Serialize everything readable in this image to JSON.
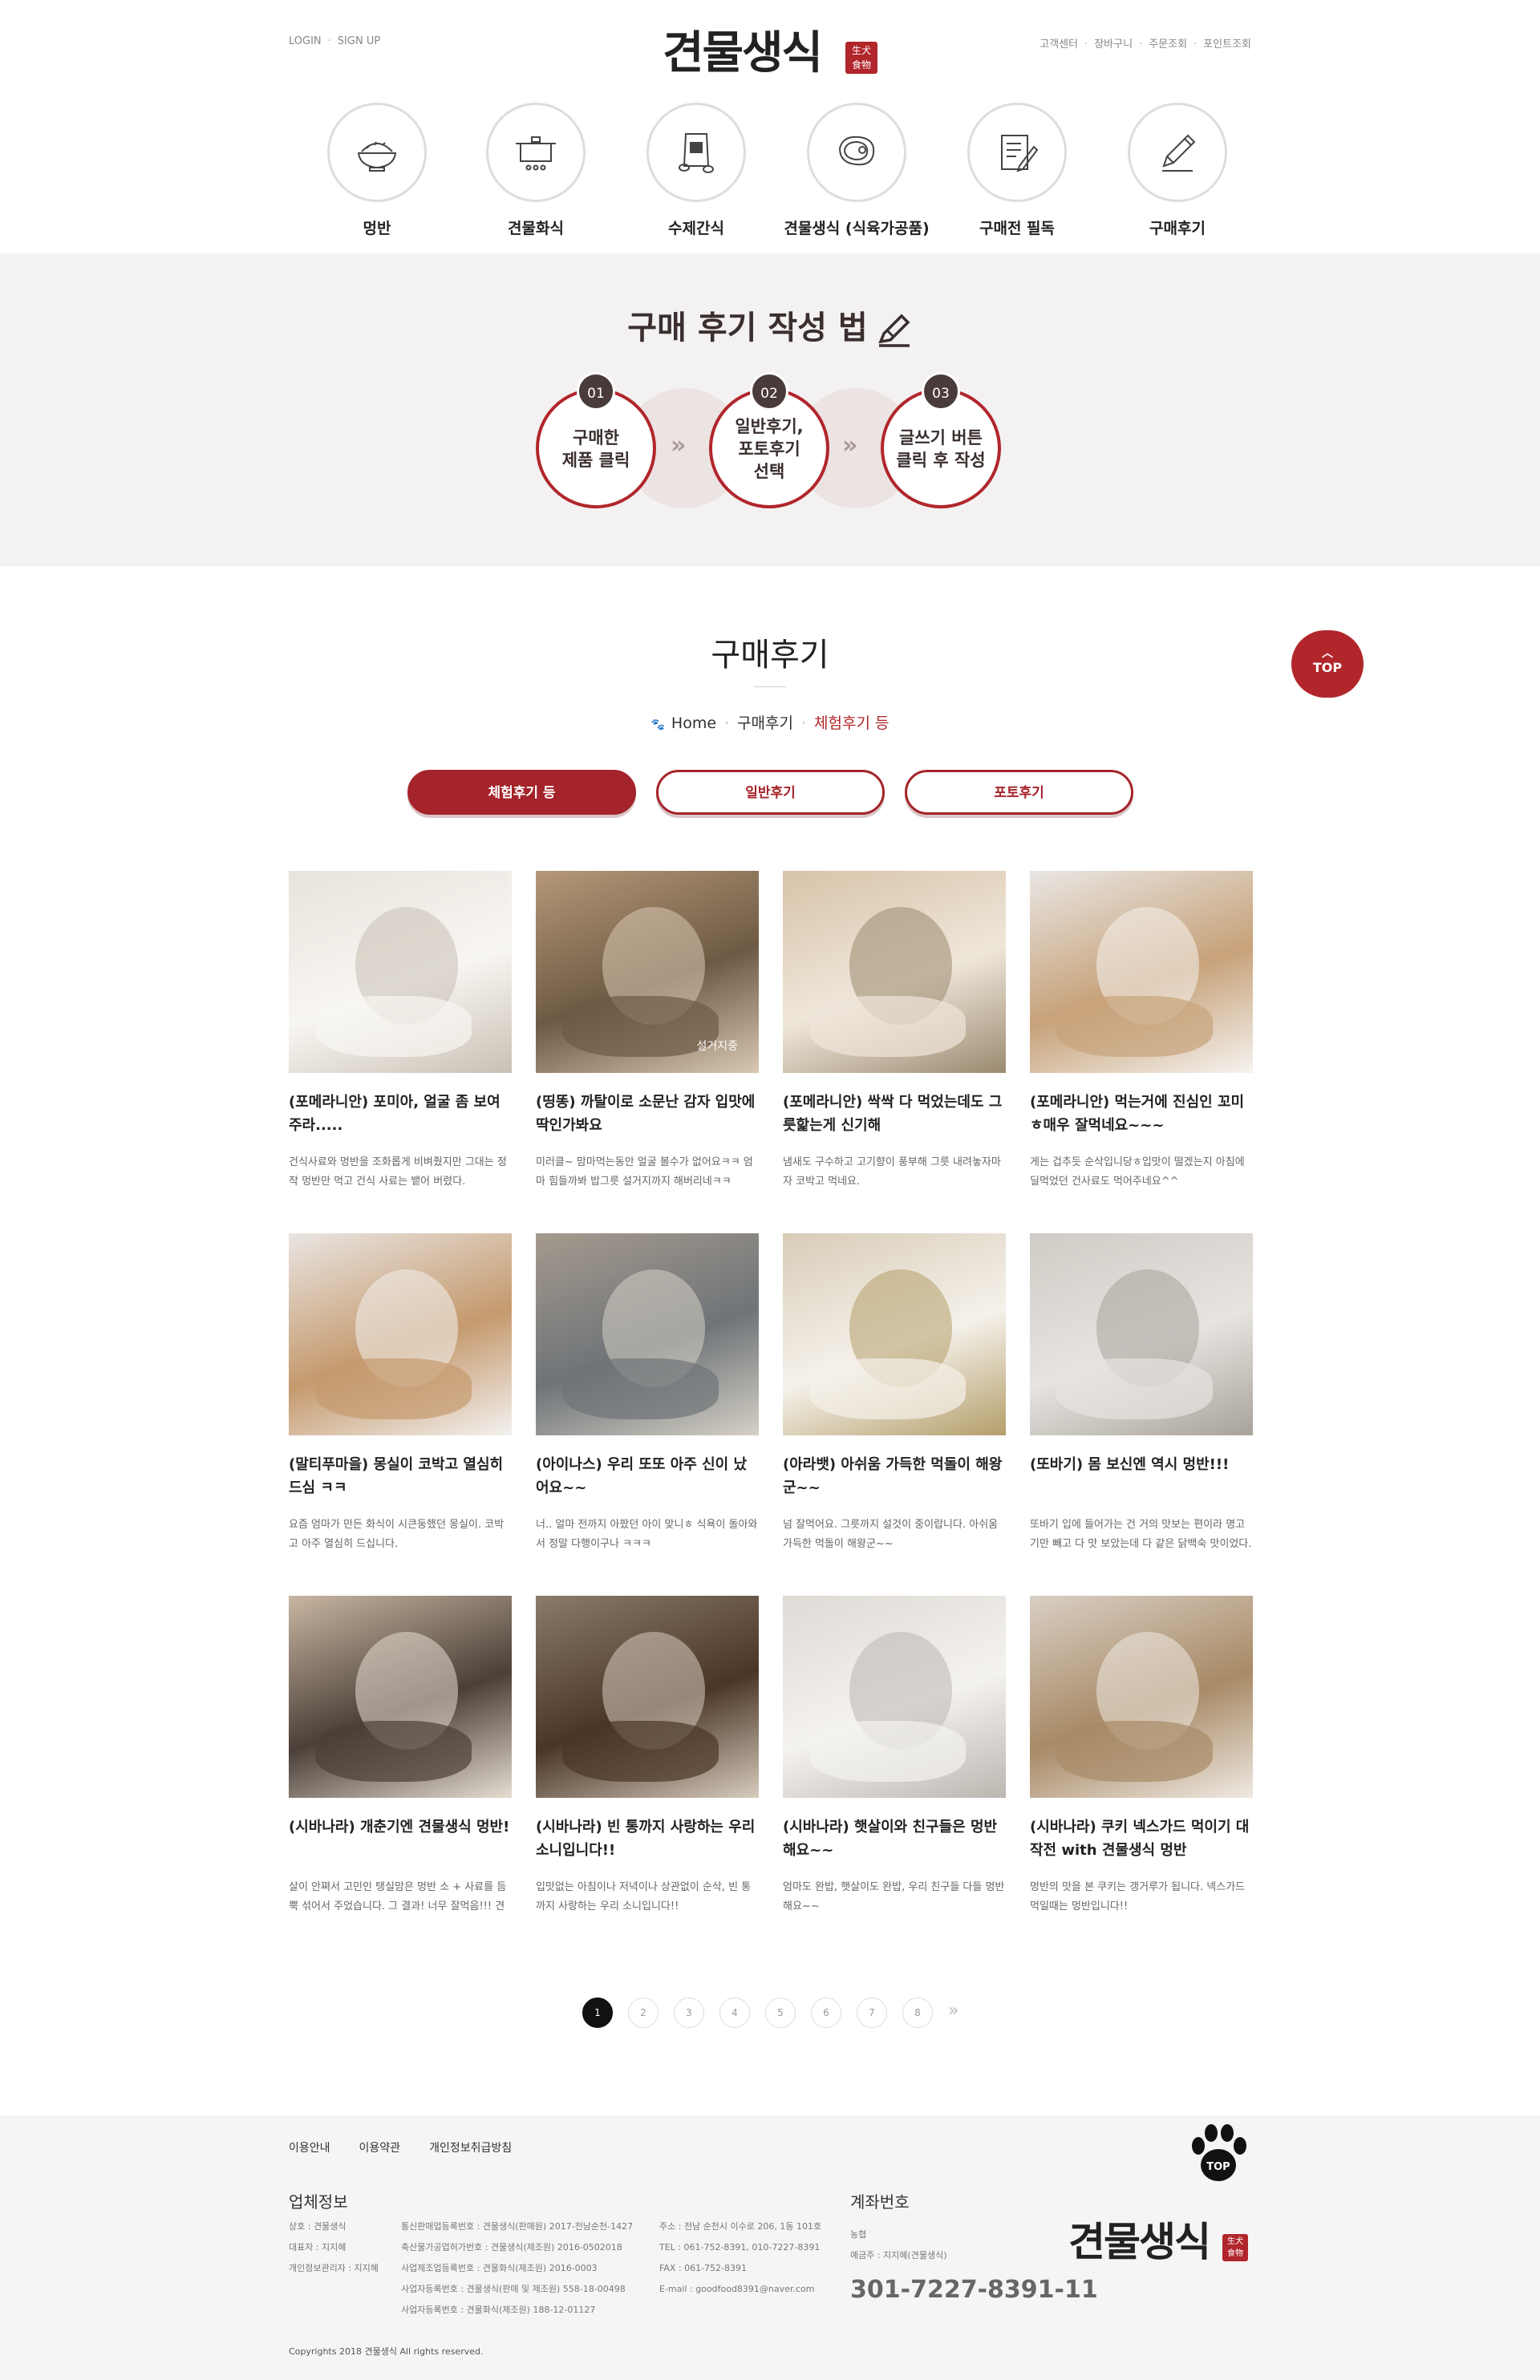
{
  "header": {
    "login": "LOGIN",
    "signup": "SIGN UP",
    "logo_text": "견물생식",
    "logo_seal": "生犬食物",
    "util": [
      "고객센터",
      "장바구니",
      "주문조회",
      "포인트조회"
    ]
  },
  "categories": [
    {
      "label": "멍반",
      "icon": "rice-bowl-icon"
    },
    {
      "label": "견물화식",
      "icon": "cooking-pot-icon"
    },
    {
      "label": "수제간식",
      "icon": "snack-bag-icon"
    },
    {
      "label": "견물생식 (식육가공품)",
      "icon": "meat-steak-icon"
    },
    {
      "label": "구매전 필독",
      "icon": "notepad-icon"
    },
    {
      "label": "구매후기",
      "icon": "pencil-icon"
    }
  ],
  "howto": {
    "title": "구매 후기 작성 법",
    "steps": [
      {
        "num": "01",
        "line1": "구매한",
        "line2": "제품 클릭",
        "line3": ""
      },
      {
        "num": "02",
        "line1": "일반후기,",
        "line2": "포토후기",
        "line3": "선택"
      },
      {
        "num": "03",
        "line1": "글쓰기 버튼",
        "line2": "클릭 후 작성",
        "line3": ""
      }
    ]
  },
  "page": {
    "title": "구매후기",
    "breadcrumb": [
      "Home",
      "구매후기",
      "체험후기 등"
    ]
  },
  "tabs": [
    "체험후기 등",
    "일반후기",
    "포토후기"
  ],
  "top_button": "TOP",
  "reviews": [
    {
      "title": "(포메라니안) 포미아, 얼굴 좀 보여주라.....",
      "desc": "건식사료와 멍반을 조화롭게 비벼줬지만 그대는 정작 멍반만 먹고 건식 사료는 뱉어 버렸다.",
      "overlay": ""
    },
    {
      "title": "(띵똥) 까탈이로 소문난 감자 입맛에 딱인가봐요",
      "desc": "미러클~ 맘마먹는동안 얼굴 볼수가 없어요ㅋㅋ 엄마 힘들까봐 밥그릇 설거지까지 해버리네ㅋㅋ",
      "overlay": "설거지중"
    },
    {
      "title": "(포메라니안) 싹싹 다 먹었는데도 그릇핥는게 신기해",
      "desc": "냄새도 구수하고 고기향이 풍부해 그릇 내려놓자마자 코박고 먹네요.",
      "overlay": ""
    },
    {
      "title": "(포메라니안) 먹는거에 진심인 꼬미ㅎ매우 잘먹네요~~~",
      "desc": "게는 겁추듯 순삭입니당ㅎ입맛이 떨겠는지 아침에 딜먹었던 건사료도 먹어주네요^^",
      "overlay": ""
    },
    {
      "title": "(말티푸마을) 몽실이 코박고 열심히 드심 ㅋㅋ",
      "desc": "요즘 엄마가 만든 화식이 시큰둥했던 몽실이. 코박고 아주 열심히 드십니다.",
      "overlay": ""
    },
    {
      "title": "(아이나스) 우리 또또 아주 신이 났어요~~",
      "desc": "너.. 얼마 전까지 아팠던 아이 맞니ㅎ 식욕이 돌아와서 정말 다행이구나 ㅋㅋㅋ",
      "overlay": ""
    },
    {
      "title": "(아라뱃) 아쉬움 가득한 먹돌이 해왕군~~",
      "desc": "넘 잘먹어요. 그릇까지 설것이 중이랍니다. 아쉬움 가득한 먹돌이 해왕군~~",
      "overlay": ""
    },
    {
      "title": "(또바기) 몸 보신엔 역시 멍반!!!",
      "desc": "또바기 입에 들어가는 건 거의 맛보는 편이라 명고기만 빼고 다 맛 보았는데 다 같은 닭백숙 맛이었다. 고기 듬뿍인 닭백숙맛!",
      "overlay": ""
    },
    {
      "title": "(시바나라) 개춘기엔 견물생식 멍반!",
      "desc": "살이 안쪄서 고민인 탱실맘은 멍반 소 + 사료를 듬뿍 섞어서 주었습니다. 그 결과! 너무 잘먹음!!! 견물생식 멍반 탱실이가 넘 좋아해요.",
      "overlay": ""
    },
    {
      "title": "(시바나라) 빈 통까지 사랑하는 우리 소니입니다!!",
      "desc": "입맛없는 아침이나 저녁이나 상관없이 순삭, 빈 통까지 사랑하는 우리 소니입니다!!",
      "overlay": ""
    },
    {
      "title": "(시바나라) 햇살이와 친구들은 멍반해요~~",
      "desc": "엄마도 완밥, 햇살이도 완밥, 우리 친구들 다들 멍반해요~~",
      "overlay": ""
    },
    {
      "title": "(시바나라) 쿠키 넥스가드 먹이기 대작전 with 견물생식 멍반",
      "desc": "멍반의 맛을 본 쿠키는 갱거루가 됩니다. 넥스가드 먹일때는 멍반입니다!!",
      "overlay": ""
    }
  ],
  "pagination": {
    "pages": [
      "1",
      "2",
      "3",
      "4",
      "5",
      "6",
      "7",
      "8"
    ],
    "current": "1",
    "next": "»"
  },
  "footer": {
    "links": [
      "이용안내",
      "이용약관",
      "개인정보취급방침"
    ],
    "company_heading": "업체정보",
    "col1": [
      "상호 : 견물생식",
      "대표자 : 지지혜",
      "개인정보관리자 : 지지혜"
    ],
    "col2": [
      "통신판매업등록번호 : 견물생식(판매원) 2017-전남순천-1427",
      "축산물가공업허가번호 : 견물생식(제조원) 2016-0502018",
      "사업제조업등록번호 : 견물화식(제조원) 2016-0003",
      "사업자등록번호 : 견물생식(판매 및 제조원) 558-18-00498",
      "사업자등록번호 : 견물화식(제조원) 188-12-01127"
    ],
    "col3": [
      "주소 : 전남 순천시 이수로 206, 1동 101호",
      "TEL : 061-752-8391, 010-7227-8391",
      "FAX : 061-752-8391",
      "E-mail : goodfood8391@naver.com"
    ],
    "account_heading": "계좌번호",
    "bank": "농협",
    "holder": "예금주 : 지지혜(견물생식)",
    "account": "301-7227-8391-11",
    "copyright": "Copyrights 2018  견물생식 All rights reserved.",
    "paw_label": "TOP"
  },
  "colors": {
    "accent": "#a5232a",
    "howto_bg": "#f3f1f1",
    "footer_bg": "#f5f5f5"
  }
}
